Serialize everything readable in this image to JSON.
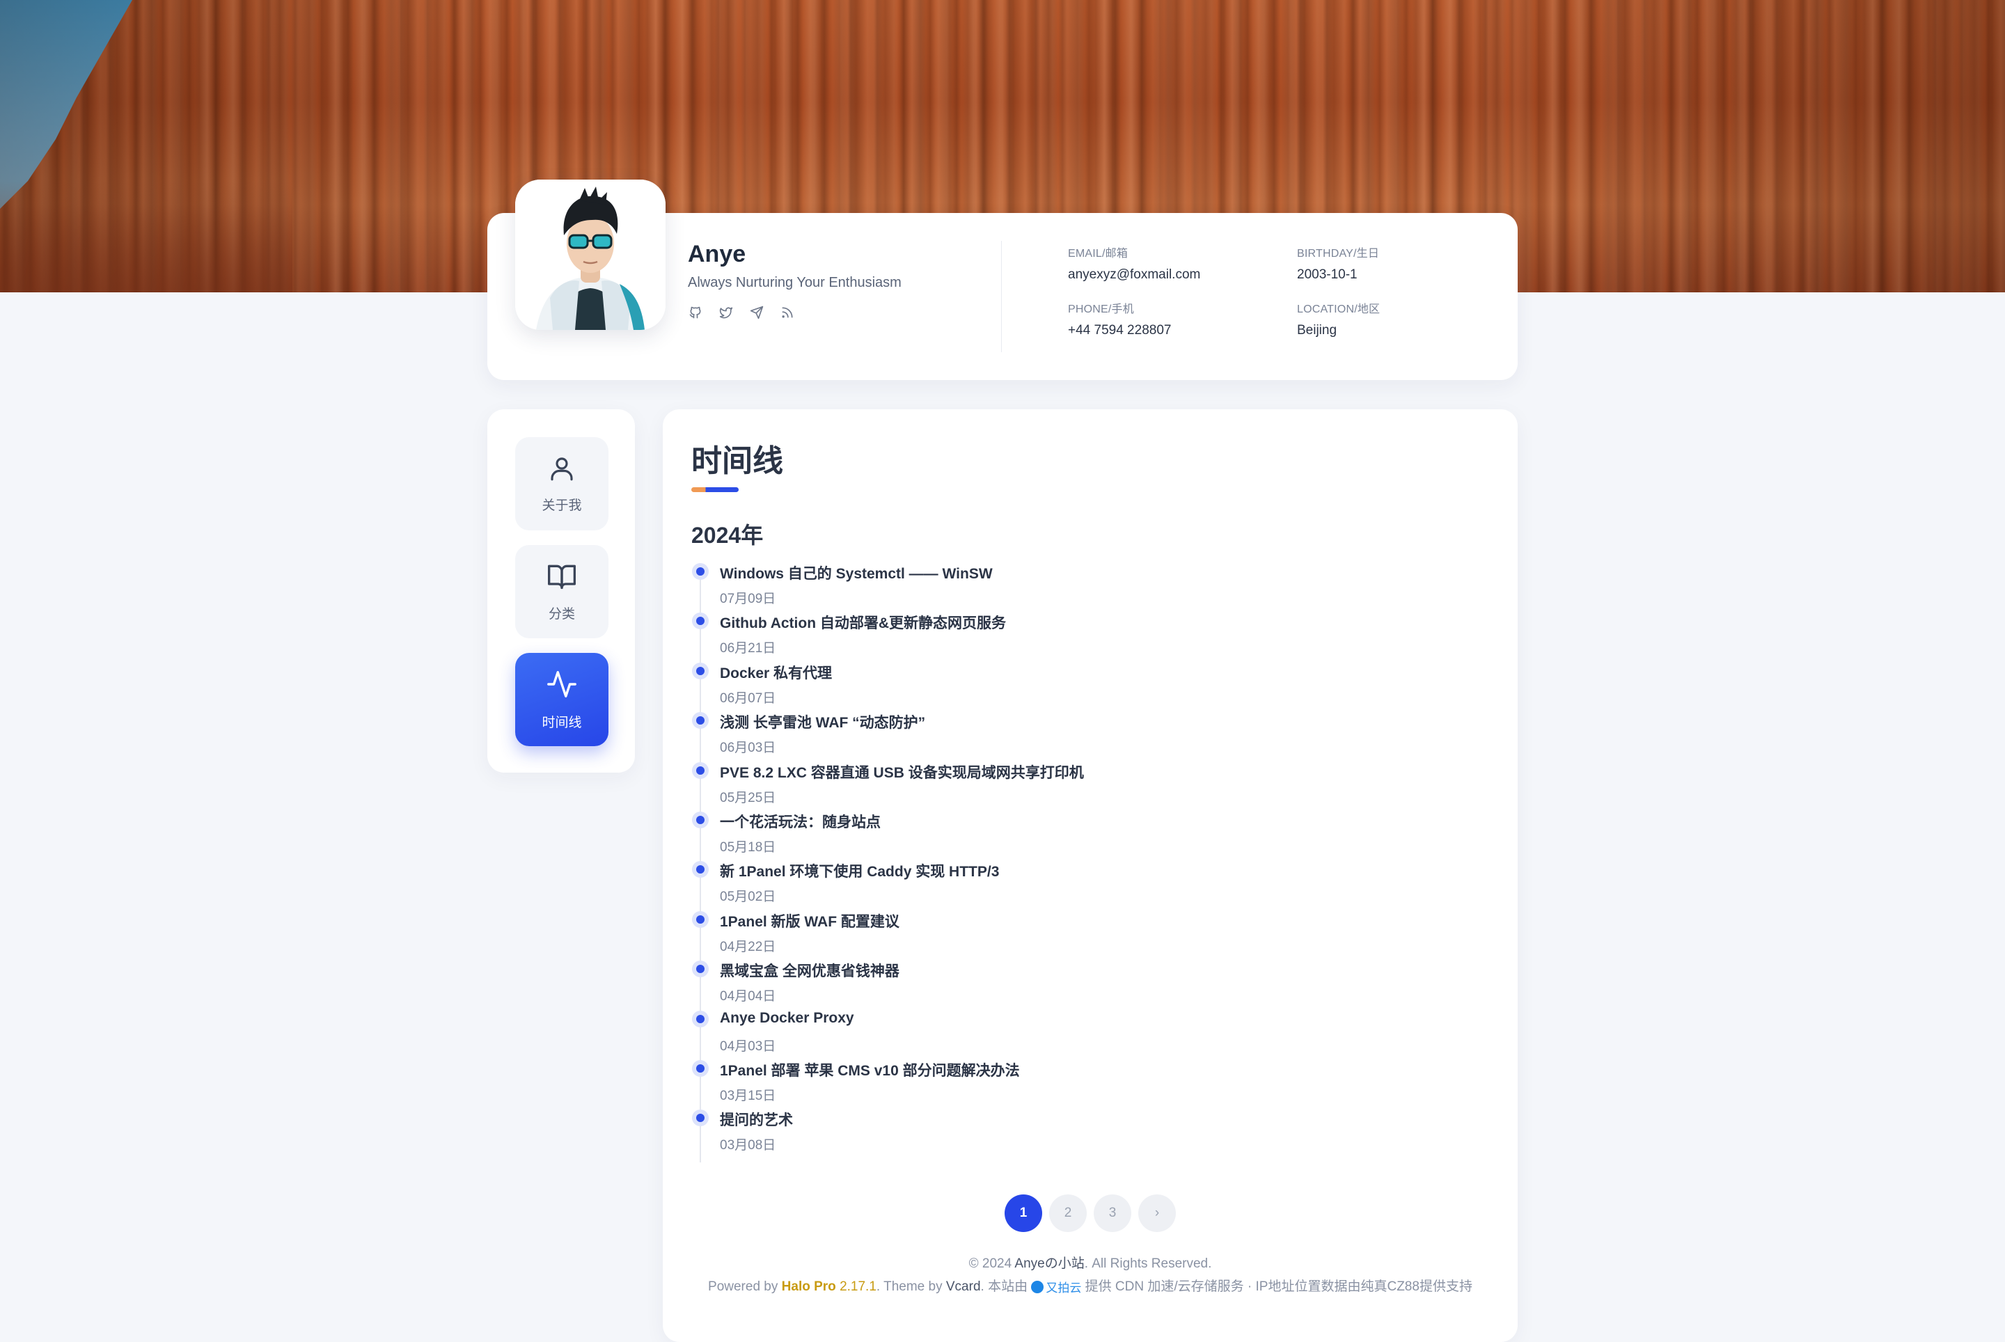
{
  "profile": {
    "name": "Anye",
    "tagline": "Always Nurturing Your Enthusiasm",
    "socials": [
      "github-icon",
      "twitter-icon",
      "telegram-icon",
      "rss-icon"
    ],
    "info": {
      "email_label": "EMAIL/邮箱",
      "email": "anyexyz@foxmail.com",
      "phone_label": "PHONE/手机",
      "phone": "+44 7594 228807",
      "birthday_label": "BIRTHDAY/生日",
      "birthday": "2003-10-1",
      "location_label": "LOCATION/地区",
      "location": "Beijing"
    }
  },
  "nav": {
    "items": [
      {
        "label": "关于我",
        "icon": "user-icon",
        "active": false
      },
      {
        "label": "分类",
        "icon": "book-icon",
        "active": false
      },
      {
        "label": "时间线",
        "icon": "activity-icon",
        "active": true
      }
    ]
  },
  "main": {
    "title": "时间线",
    "year": "2024年",
    "posts": [
      {
        "title": "Windows 自己的 Systemctl —— WinSW",
        "date": "07月09日"
      },
      {
        "title": "Github Action 自动部署&更新静态网页服务",
        "date": "06月21日"
      },
      {
        "title": "Docker 私有代理",
        "date": "06月07日"
      },
      {
        "title": "浅测 长亭雷池 WAF “动态防护”",
        "date": "06月03日"
      },
      {
        "title": "PVE 8.2 LXC 容器直通 USB 设备实现局域网共享打印机",
        "date": "05月25日"
      },
      {
        "title": "一个花活玩法：随身站点",
        "date": "05月18日"
      },
      {
        "title": "新 1Panel 环境下使用 Caddy 实现 HTTP/3",
        "date": "05月02日"
      },
      {
        "title": "1Panel 新版 WAF 配置建议",
        "date": "04月22日"
      },
      {
        "title": "黑域宝盒 全网优惠省钱神器",
        "date": "04月04日"
      },
      {
        "title": "Anye Docker Proxy",
        "date": "04月03日"
      },
      {
        "title": "1Panel 部署 苹果 CMS v10 部分问题解决办法",
        "date": "03月15日"
      },
      {
        "title": "提问的艺术",
        "date": "03月08日"
      }
    ]
  },
  "pagination": {
    "pages": [
      "1",
      "2",
      "3"
    ],
    "current": "1",
    "next": "›"
  },
  "footer": {
    "copyright_prefix": "© 2024",
    "site_name": "Anyeの小站",
    "rights": ". All Rights Reserved.",
    "powered_by": "Powered by",
    "halo": "Halo Pro",
    "version": "2.17.1",
    "theme_by": ". Theme by",
    "theme": "Vcard",
    "hosted_by": ". 本站由",
    "cdn_name": "又拍云",
    "cdn_text": "提供 CDN 加速/云存储服务 · IP地址位置数据由纯真CZ88提供支持"
  },
  "colors": {
    "accent": "#2746e8",
    "title_bar_orange": "#f09a54",
    "halo_gold": "#c89b12"
  }
}
